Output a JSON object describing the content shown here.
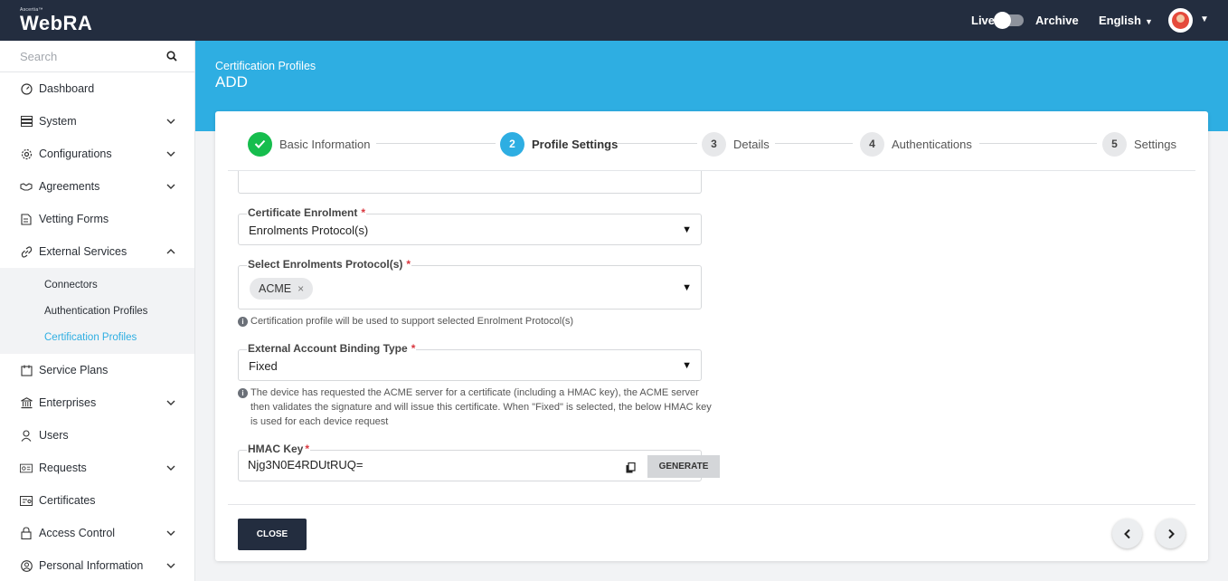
{
  "app": {
    "brand_small": "Ascertia™",
    "brand": "WebRA"
  },
  "topbar": {
    "live_label": "Live",
    "archive_label": "Archive",
    "language": "English"
  },
  "sidebar": {
    "search_placeholder": "Search",
    "items": [
      {
        "label": "Dashboard"
      },
      {
        "label": "System"
      },
      {
        "label": "Configurations"
      },
      {
        "label": "Agreements"
      },
      {
        "label": "Vetting Forms"
      },
      {
        "label": "External Services"
      },
      {
        "label": "Service Plans"
      },
      {
        "label": "Enterprises"
      },
      {
        "label": "Users"
      },
      {
        "label": "Requests"
      },
      {
        "label": "Certificates"
      },
      {
        "label": "Access Control"
      },
      {
        "label": "Personal Information"
      }
    ],
    "sub_items": [
      {
        "label": "Connectors"
      },
      {
        "label": "Authentication Profiles"
      },
      {
        "label": "Certification Profiles"
      }
    ]
  },
  "header": {
    "breadcrumb": "Certification Profiles",
    "title": "ADD"
  },
  "wizard": {
    "steps": [
      {
        "num": "",
        "label": "Basic Information",
        "state": "done"
      },
      {
        "num": "2",
        "label": "Profile Settings",
        "state": "current"
      },
      {
        "num": "3",
        "label": "Details",
        "state": "pending"
      },
      {
        "num": "4",
        "label": "Authentications",
        "state": "pending"
      },
      {
        "num": "5",
        "label": "Settings",
        "state": "pending"
      }
    ]
  },
  "form": {
    "cert_enrolment": {
      "label": "Certificate Enrolment",
      "required": "*",
      "value": "Enrolments Protocol(s)"
    },
    "enrol_protocols": {
      "label": "Select Enrolments Protocol(s)",
      "required": "*",
      "chip": "ACME",
      "chip_remove": "×",
      "help": "Certification profile will be used to support selected Enrolment Protocol(s)"
    },
    "eab_type": {
      "label": "External Account Binding Type",
      "required": "*",
      "value": "Fixed",
      "help": "The device has requested the ACME server for a certificate (including a HMAC key), the ACME server then validates the signature and will issue this certificate. When \"Fixed\" is selected, the below HMAC key is used for each device request"
    },
    "hmac": {
      "label": "HMAC Key",
      "required": "*",
      "value": "Njg3N0E4RDUtRUQ=",
      "generate_label": "GENERATE"
    }
  },
  "footer": {
    "close_label": "CLOSE"
  },
  "colors": {
    "accent": "#2eaee2",
    "topbar": "#232d3f",
    "done": "#16bd4d"
  }
}
